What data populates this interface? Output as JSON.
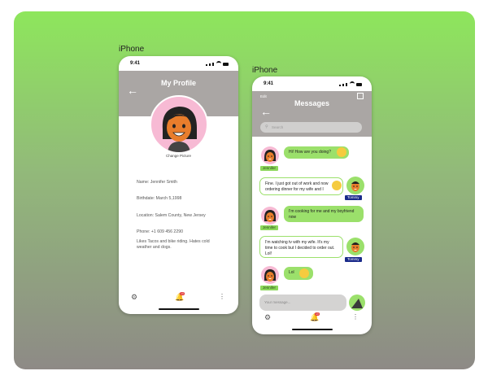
{
  "frames": {
    "left_label": "iPhone",
    "right_label": "iPhone"
  },
  "profile": {
    "time": "9:41",
    "title": "My Profile",
    "change_picture": "Change Picture",
    "name": "Name: Jennifer Smith",
    "birthdate": "Birthdate: March 5,1998",
    "location": "Location: Salem County, New Jersey",
    "phone": "Phone: +1 609 456 2290",
    "likes": "Likes Tacos and bike riding. Hates cold weather and dogs.",
    "notif_count": "10"
  },
  "messages": {
    "time": "9:41",
    "edit": "Edit",
    "title": "Messages",
    "search_placeholder": "Search",
    "input_placeholder": "Your message...",
    "notif_count": "10",
    "items": [
      {
        "sender": "Jennifer",
        "text": "Hi! How are you doing?"
      },
      {
        "sender": "Tommy",
        "text": "Fine. I just got out of work and now ordering dinner for my wife and I"
      },
      {
        "sender": "Jennifer",
        "text": "I'm cooking for me and my boyfriend now"
      },
      {
        "sender": "Tommy",
        "text": "I'm watching tv with my wife. It's my time to cook but I decided to order out. Lol!"
      },
      {
        "sender": "Jennifer",
        "text": "Lol"
      }
    ]
  },
  "colors": {
    "accent_green": "#9be06b",
    "header_gray": "#aaa6a4",
    "tommy_tag": "#1a2a8a",
    "notif_red": "#e03030"
  }
}
